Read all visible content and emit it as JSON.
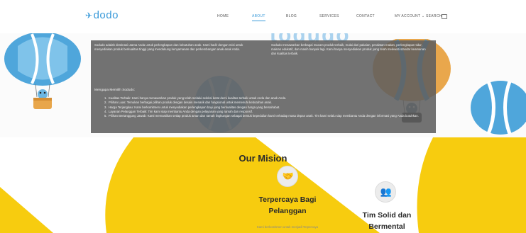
{
  "header": {
    "logo": "dodo",
    "nav": [
      {
        "label": "HOME",
        "active": false
      },
      {
        "label": "ABOUT",
        "active": true
      },
      {
        "label": "BLOG",
        "active": false
      },
      {
        "label": "SERVICES",
        "active": false
      },
      {
        "label": "CONTACT",
        "active": false
      },
      {
        "label": "MY ACCOUNT ⌄",
        "active": false
      },
      {
        "label": "SEARCH",
        "active": false
      }
    ]
  },
  "hero": {
    "background_word": "todudo",
    "overlay": {
      "left_paragraph": "Sodudo adalah destinasi utama Anda untuk perlengkapan dan kebutuhan anak. Kami hadir dengan misi untuk menyediakan produk berkualitas tinggi yang mendukung kenyamanan dan perkembangan anak-anak Anda.",
      "right_paragraph": "Sodudo menawarkan berbagai macam produk terbaik, mulai dari pakaian, peralatan makan, perlengkapan tidur, mainan edukatif, dan masih banyak lagi. Kami hanya menyediakan produk yang telah melewati standar keamanan dan kualitas terbaik.",
      "list_heading": "Mengapa Memilih Sodudo:",
      "list": [
        "Kualitas Terbaik: Kami hanya menawarkan produk yang telah melalui seleksi ketat demi kualitas terbaik untuk Anda dan anak Anda.",
        "Pilihan Luas: Temukan berbagai pilihan produk dengan desain menarik dan fungsional untuk memenuhi kebutuhan anak.",
        "Harga Terjangkau: Kami berkomitmen untuk menyediakan perlengkapan bayi yang berkualitas dengan harga yang bersahabat.",
        "Layanan Pelanggan Terbaik: Tim kami siap membantu Anda dengan pelayanan yang ramah dan responsif.",
        "Pilihan Bertanggung Jawab: Kami memastikan setiap produk aman dan ramah lingkungan sebagai bentuk kepedulian kami terhadap masa depan anak. Tim kami selalu siap membantu Anda dengan informasi yang Anda butuhkan."
      ]
    }
  },
  "mission": {
    "title": "Our Mision",
    "cards": [
      {
        "icon": "handshake-icon",
        "title_line1": "Terpercaya Bagi",
        "title_line2": "Pelanggan",
        "text": "Kami berkomitmen untuk menjadi Terpercaya"
      },
      {
        "icon": "team-icon",
        "title_line1": "Tim Solid dan",
        "title_line2": "Bermental",
        "text": ""
      }
    ]
  },
  "colors": {
    "accent": "#3a9ad9",
    "yellow": "#f7cc0f",
    "overlay": "#5f5f5f",
    "balloon_blue": "#55a9dc",
    "balloon_orange": "#e8a64a"
  }
}
